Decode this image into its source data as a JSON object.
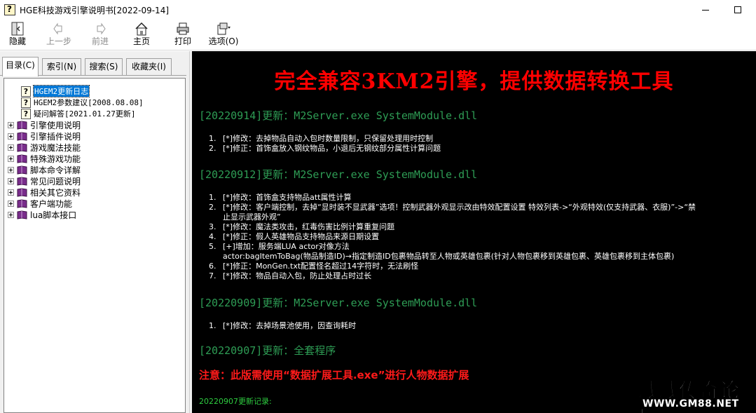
{
  "window": {
    "title": "HGE科技游戏引擎说明书[2022-09-14]"
  },
  "toolbar": {
    "hide_label": "隐藏",
    "back_label": "上一步",
    "forward_label": "前进",
    "home_label": "主页",
    "print_label": "打印",
    "options_label": "选项(O)"
  },
  "tabs": [
    {
      "label": "目录(C)"
    },
    {
      "label": "索引(N)"
    },
    {
      "label": "搜索(S)"
    },
    {
      "label": "收藏夹(I)"
    }
  ],
  "tree": [
    {
      "label": "HGEM2更新日志"
    },
    {
      "label": "HGEM2参数建议[2008.08.08]"
    },
    {
      "label": "疑问解答[2021.01.27更新]"
    },
    {
      "label": "引擎使用说明"
    },
    {
      "label": "引擎插件说明"
    },
    {
      "label": "游戏魔法技能"
    },
    {
      "label": "特殊游戏功能"
    },
    {
      "label": "脚本命令详解"
    },
    {
      "label": "常见问题说明"
    },
    {
      "label": "相关其它资料"
    },
    {
      "label": "客户端功能"
    },
    {
      "label": "lua脚本接口"
    }
  ],
  "content": {
    "banner": "完全兼容3KM2引擎，提供数据转换工具",
    "sections": [
      {
        "heading": "[20220914]更新：M2Server.exe SystemModule.dll",
        "items": [
          {
            "num": "1.",
            "text": "[*]修改：去掉物品自动入包时数量限制，只保留处理用时控制"
          },
          {
            "num": "2.",
            "text": "[*]修正：首饰盒放入钢纹物品，小退后无钢纹部分属性计算问题"
          }
        ]
      },
      {
        "heading": "[20220912]更新：M2Server.exe SystemModule.dll",
        "items": [
          {
            "num": "1.",
            "text": "[*]修改：首饰盒支持物品att属性计算"
          },
          {
            "num": "2.",
            "text": "[*]修改：客户端控制，去掉“显时装不显武器”选项！控制武器外观显示改由特效配置设置 特效列表->“外观特效(仅支持武器、衣服)”->“禁"
          },
          {
            "num": "",
            "text": "止显示武器外观”"
          },
          {
            "num": "3.",
            "text": "[*]修改：魔法类攻击，红毒伤害比例计算重复问题"
          },
          {
            "num": "4.",
            "text": "[*]修正：假人英雄物品支持物品来源日期设置"
          },
          {
            "num": "5.",
            "text": "[+]增加：服务端LUA actor对像方法"
          },
          {
            "num": "",
            "text": "actor:bagItemToBag(物品制造ID)→指定制造ID包裹物品转至人物或英雄包裹(针对人物包裹移到英雄包裹、英雄包裹移到主体包裹)"
          },
          {
            "num": "6.",
            "text": "[*]修正：MonGen.txt配置怪名超过14字符时，无法刷怪"
          },
          {
            "num": "7.",
            "text": "[*]修改：物品自动入包，防止处理占时过长"
          }
        ]
      },
      {
        "heading": "[20220909]更新：M2Server.exe SystemModule.dll",
        "items": [
          {
            "num": "1.",
            "text": "[*]修改：去掉场景池使用，因查询耗时"
          }
        ]
      },
      {
        "heading": "[20220907]更新：全套程序",
        "items": []
      }
    ],
    "notice": "注意：此版需使用“数据扩展工具.exe”进行人物数据扩展",
    "changelog_label": "20220907更新记录:"
  },
  "watermark": {
    "text": "威威传奇论坛",
    "url": "WWW.GM88.NET"
  },
  "colors": {
    "content_bg": "#000000",
    "banner": "#ff0000",
    "heading": "#2e9d55",
    "notice": "#ff1a1a",
    "selection": "#0078d7"
  }
}
